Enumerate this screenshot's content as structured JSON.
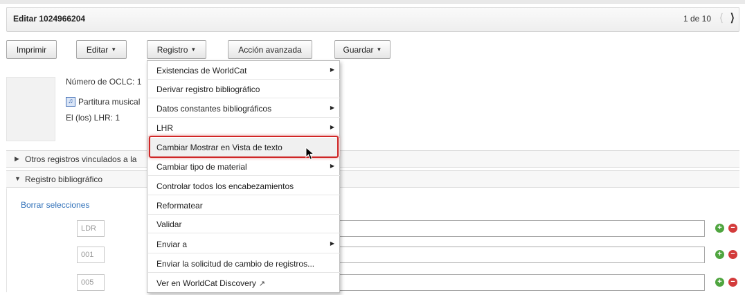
{
  "header": {
    "title": "Editar 1024966204",
    "pager": "1 de 10",
    "prev_icon": "chevron-left-icon",
    "next_icon": "chevron-right-icon"
  },
  "toolbar": {
    "print": "Imprimir",
    "edit": "Editar",
    "record": "Registro",
    "advanced": "Acción avanzada",
    "save": "Guardar"
  },
  "summary": {
    "oclc": "Número de OCLC: 1",
    "format": "Partitura musical",
    "lhr": "El (los) LHR: 1"
  },
  "sections": {
    "linked": "Otros registros vinculados a la",
    "bib": "Registro bibliográfico",
    "clear": "Borrar selecciones"
  },
  "fields": [
    {
      "tag": "LDR"
    },
    {
      "tag": "001"
    },
    {
      "tag": "005"
    }
  ],
  "menu": {
    "items": [
      {
        "label": "Existencias de WorldCat",
        "submenu": true
      },
      {
        "label": "Derivar registro bibliográfico",
        "submenu": false
      },
      {
        "label": "Datos constantes bibliográficos",
        "submenu": true
      },
      {
        "label": "LHR",
        "submenu": true
      },
      {
        "label": "Cambiar Mostrar en Vista de texto",
        "submenu": false,
        "highlighted": true
      },
      {
        "label": "Cambiar tipo de material",
        "submenu": true
      },
      {
        "label": "Controlar todos los encabezamientos",
        "submenu": false
      },
      {
        "label": "Reformatear",
        "submenu": false
      },
      {
        "label": "Validar",
        "submenu": false
      },
      {
        "label": "Enviar a",
        "submenu": true
      },
      {
        "label": "Enviar la solicitud de cambio de registros...",
        "submenu": false
      },
      {
        "label": "Ver en WorldCat Discovery",
        "submenu": false,
        "icon": "external-link-icon"
      }
    ]
  },
  "colors": {
    "highlight_border": "#d02626",
    "link": "#2e6fb8",
    "add": "#4fa53f",
    "remove": "#d33b3b"
  }
}
